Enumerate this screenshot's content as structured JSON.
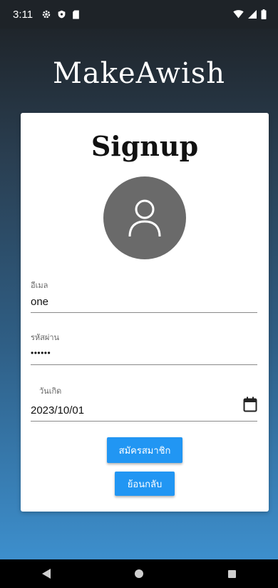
{
  "status_bar": {
    "time": "3:11",
    "left_icons": [
      "gear-icon",
      "shield-icon",
      "sd-card-icon"
    ],
    "right_icons": [
      "wifi-icon",
      "signal-icon",
      "battery-icon"
    ]
  },
  "app": {
    "title": "MakeAwish"
  },
  "card": {
    "title": "Signup",
    "avatar_icon": "user-icon",
    "email": {
      "label": "อีเมล",
      "value": "one"
    },
    "password": {
      "label": "รหัสผ่าน",
      "value": "••••••"
    },
    "birthdate": {
      "label": "วันเกิด",
      "value": "2023/10/01",
      "icon": "calendar-icon"
    },
    "signup_button": "สมัครสมาชิก",
    "back_button": "ย้อนกลับ"
  },
  "nav_bar": {
    "icons": [
      "back-icon",
      "home-icon",
      "recents-icon"
    ]
  },
  "colors": {
    "primary": "#2196f3",
    "status_bar": "#1e2328",
    "avatar": "#6a6a6a"
  }
}
